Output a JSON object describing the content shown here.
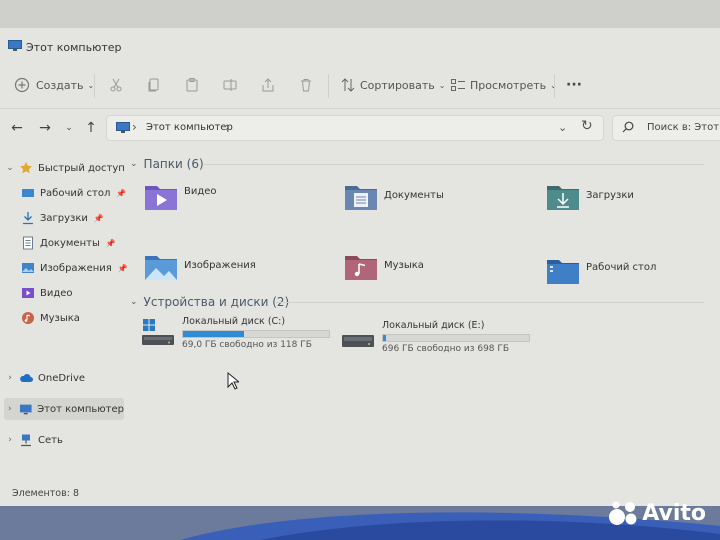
{
  "window": {
    "title": "Этот компьютер"
  },
  "toolbar": {
    "new_label": "Создать",
    "sort_label": "Сортировать",
    "view_label": "Просмотреть",
    "more_label": "···"
  },
  "address": {
    "path": "Этот компьютер",
    "separator": "›",
    "search_placeholder": "Поиск в: Этот ко"
  },
  "sidebar": {
    "items": [
      {
        "label": "Быстрый доступ",
        "icon": "star-icon"
      },
      {
        "label": "Рабочий стол",
        "icon": "desktop-icon",
        "pinned": true
      },
      {
        "label": "Загрузки",
        "icon": "download-icon",
        "pinned": true
      },
      {
        "label": "Документы",
        "icon": "documents-icon",
        "pinned": true
      },
      {
        "label": "Изображения",
        "icon": "pictures-icon",
        "pinned": true
      },
      {
        "label": "Видео",
        "icon": "video-icon"
      },
      {
        "label": "Музыка",
        "icon": "music-icon"
      },
      {
        "label": "OneDrive",
        "icon": "cloud-icon"
      },
      {
        "label": "Этот компьютер",
        "icon": "computer-icon",
        "selected": true
      },
      {
        "label": "Сеть",
        "icon": "network-icon"
      }
    ]
  },
  "folders_group": {
    "title": "Папки (6)",
    "items": [
      {
        "label": "Видео",
        "icon": "video-folder-icon"
      },
      {
        "label": "Документы",
        "icon": "documents-folder-icon"
      },
      {
        "label": "Загрузки",
        "icon": "downloads-folder-icon"
      },
      {
        "label": "Изображения",
        "icon": "pictures-folder-icon"
      },
      {
        "label": "Музыка",
        "icon": "music-folder-icon"
      },
      {
        "label": "Рабочий стол",
        "icon": "desktop-folder-icon"
      }
    ]
  },
  "drives_group": {
    "title": "Устройства и диски (2)",
    "drives": [
      {
        "name": "Локальный диск (C:)",
        "info": "69,0 ГБ свободно из 118 ГБ",
        "used_fraction": 0.42
      },
      {
        "name": "Локальный диск (E:)",
        "info": "696 ГБ свободно из 698 ГБ",
        "used_fraction": 0.01
      }
    ]
  },
  "status": {
    "text": "Элементов: 8"
  },
  "watermark": {
    "text": "Avito"
  },
  "colors": {
    "accent": "#2f8bd6",
    "folder": "#5b7fb0"
  }
}
